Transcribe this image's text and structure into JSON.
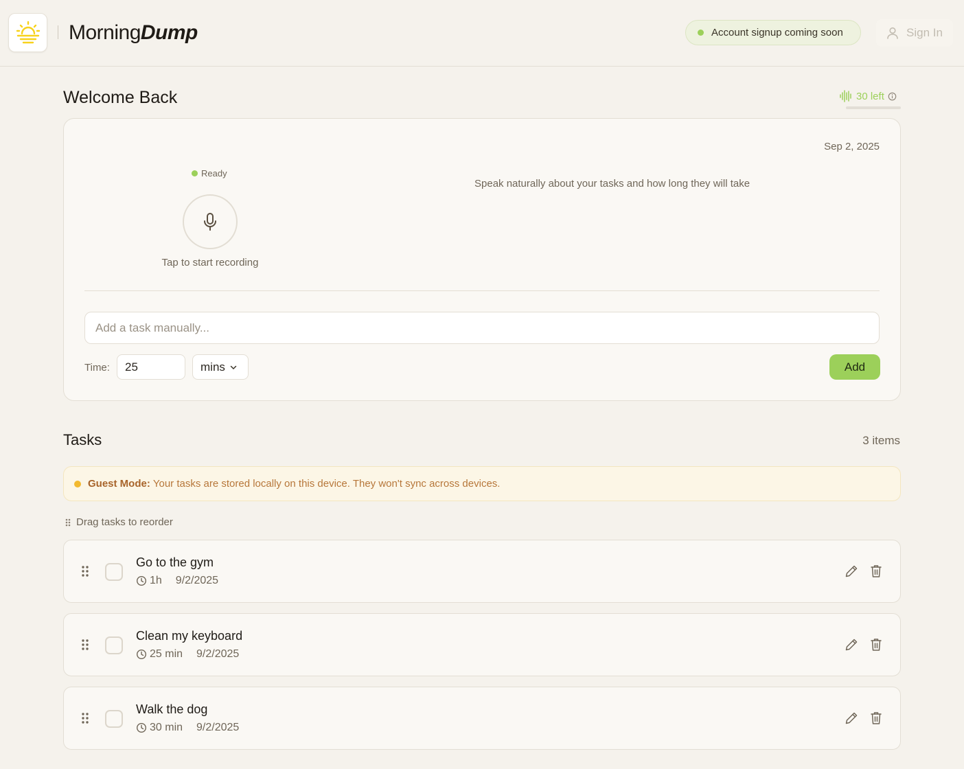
{
  "header": {
    "brand_regular": "Morning",
    "brand_bold": "Dump",
    "signup_notice": "Account signup coming soon",
    "sign_in_label": "Sign In"
  },
  "welcome": {
    "title": "Welcome Back",
    "credits_left": "30 left"
  },
  "recorder": {
    "date": "Sep 2, 2025",
    "status": "Ready",
    "tap_hint": "Tap to start recording",
    "speak_hint": "Speak naturally about your tasks and how long they will take",
    "task_input_placeholder": "Add a task manually...",
    "time_label": "Time:",
    "time_value": "25",
    "time_unit": "mins",
    "add_label": "Add"
  },
  "tasks": {
    "title": "Tasks",
    "count": "3 items",
    "guest_label": "Guest Mode:",
    "guest_message": "Your tasks are stored locally on this device. They won't sync across devices.",
    "drag_hint": "Drag tasks to reorder",
    "items": [
      {
        "title": "Go to the gym",
        "duration": "1h",
        "date": "9/2/2025"
      },
      {
        "title": "Clean my keyboard",
        "duration": "25 min",
        "date": "9/2/2025"
      },
      {
        "title": "Walk the dog",
        "duration": "30 min",
        "date": "9/2/2025"
      }
    ]
  },
  "colors": {
    "accent_green": "#9cd05a",
    "warning_amber": "#f2b92f",
    "logo_yellow": "#f7d21c",
    "background": "#f5f2ec"
  },
  "icons": [
    "sun-logo-icon",
    "user-icon",
    "waveform-icon",
    "info-icon",
    "microphone-icon",
    "chevron-down-icon",
    "drag-handle-icon",
    "clock-icon",
    "pencil-icon",
    "trash-icon"
  ]
}
